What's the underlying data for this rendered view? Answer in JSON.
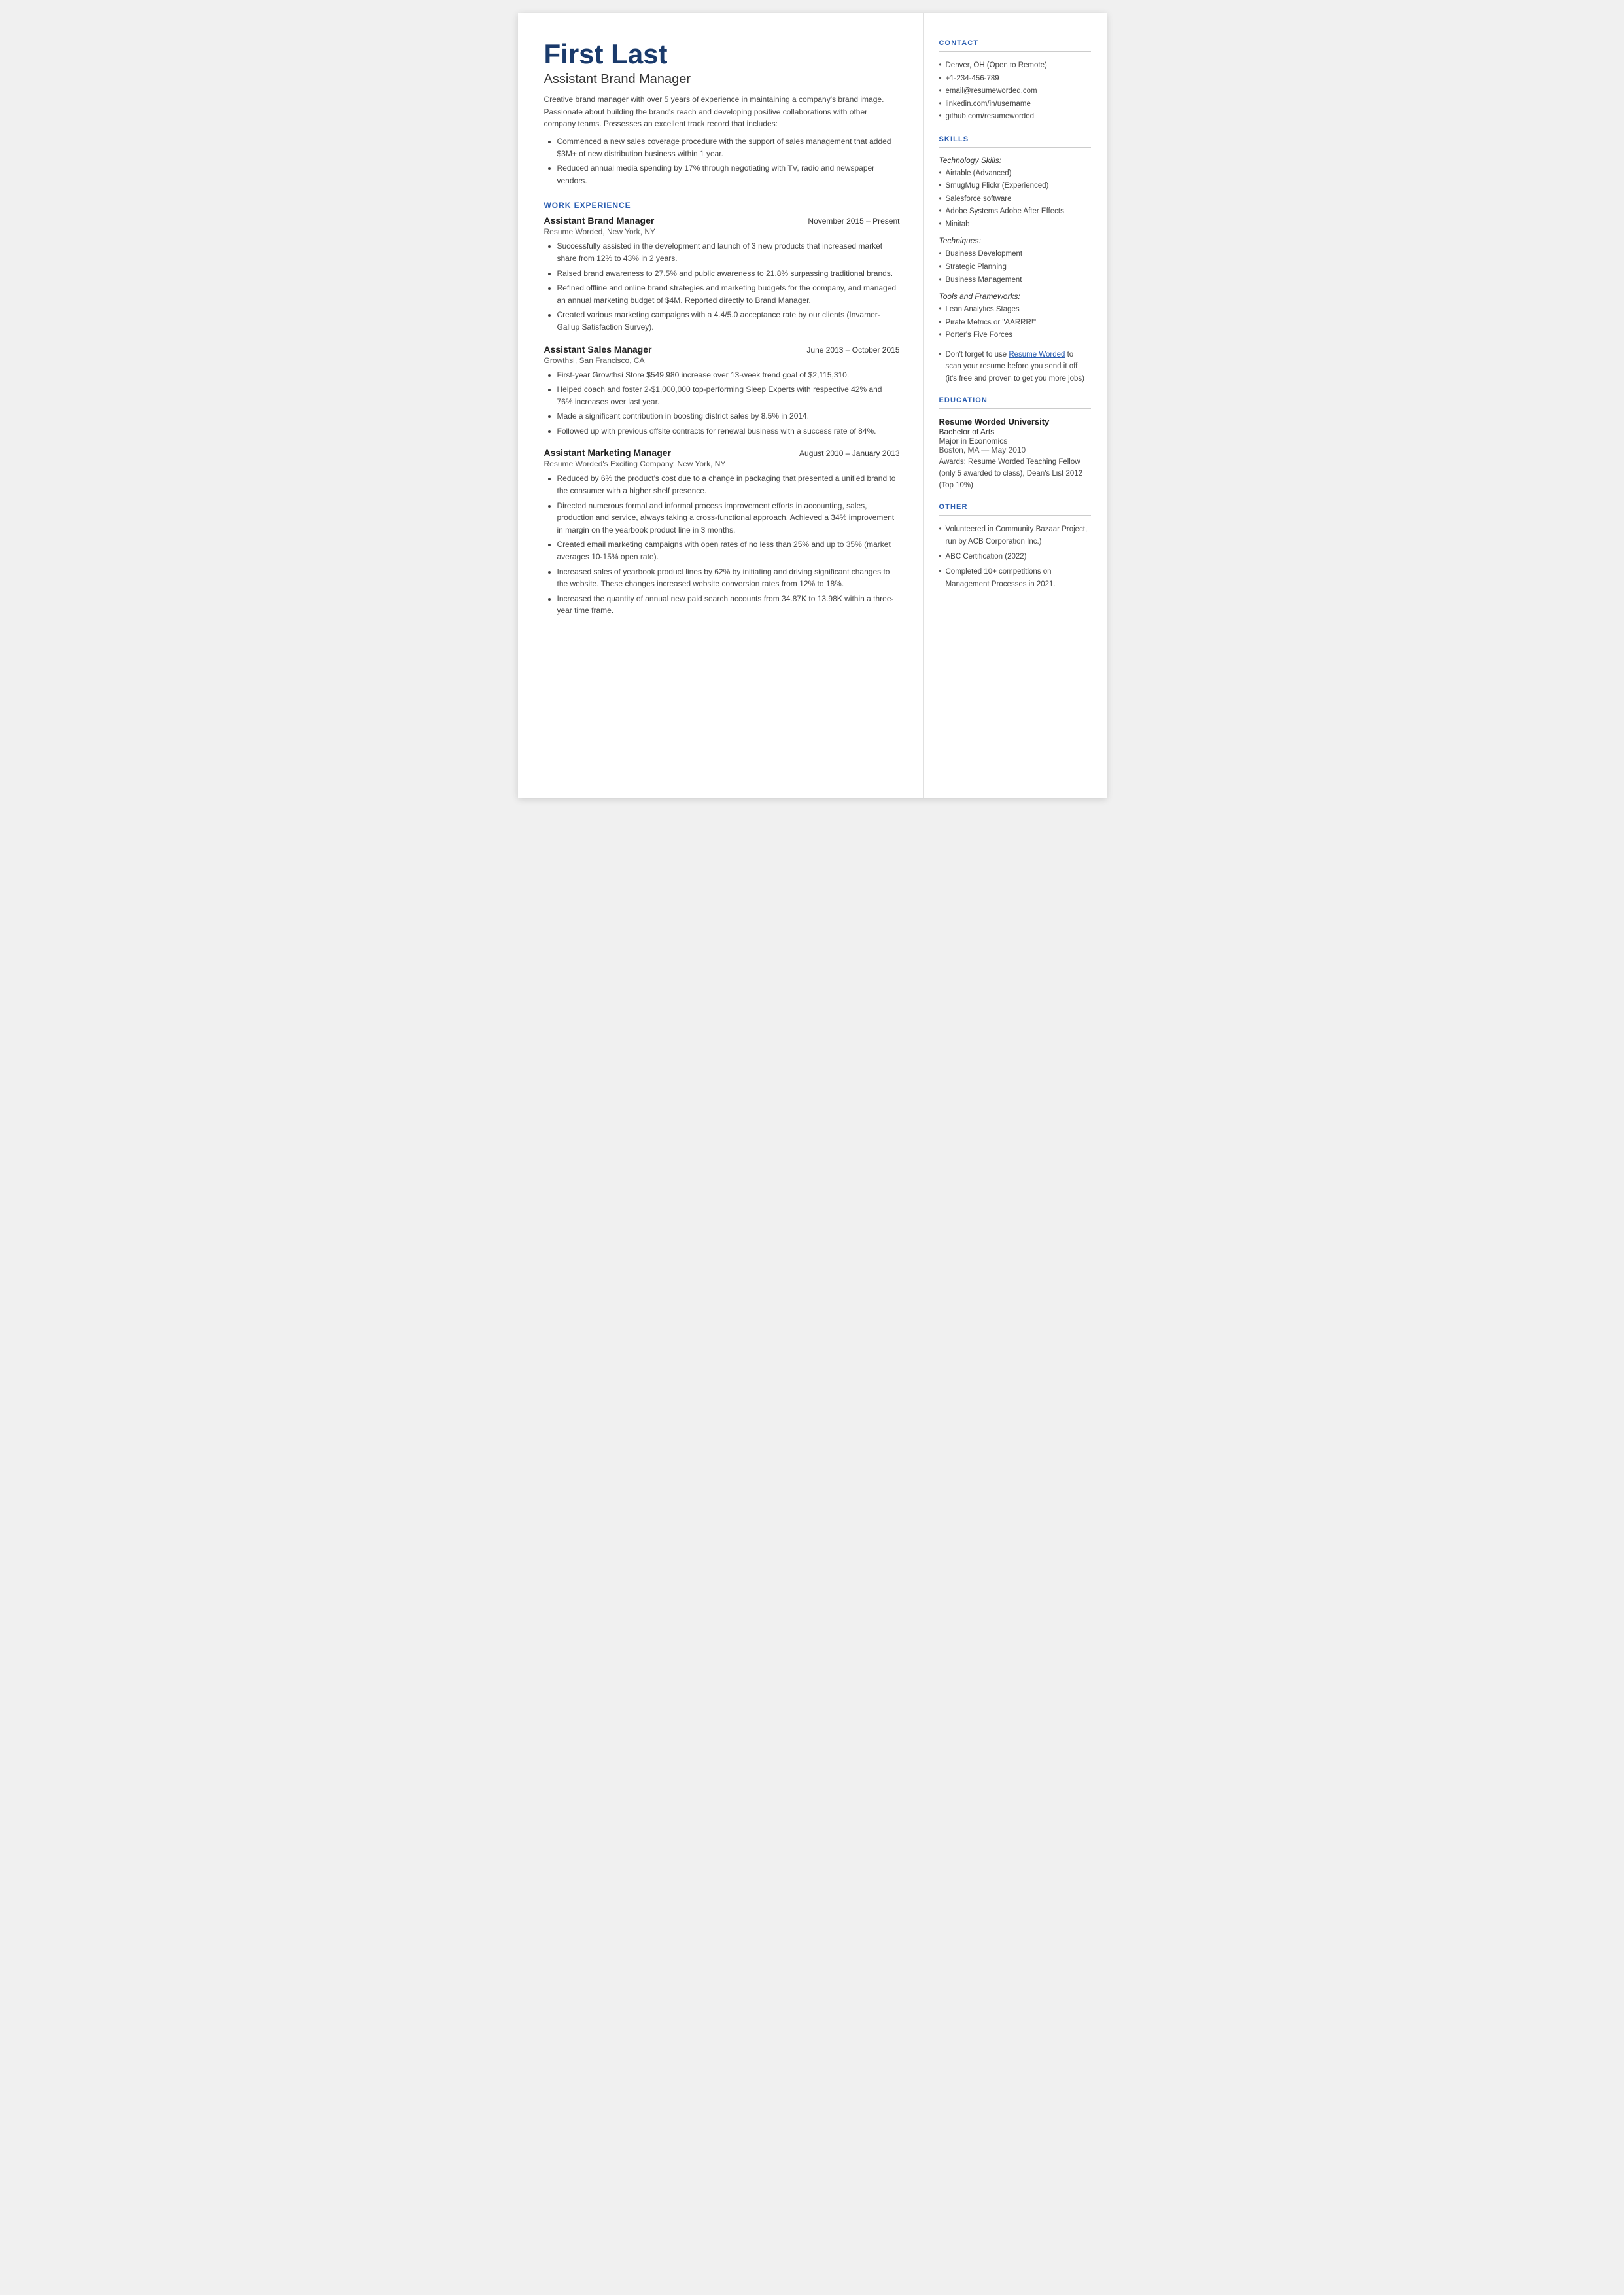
{
  "header": {
    "name": "First Last",
    "job_title": "Assistant Brand Manager",
    "summary": "Creative brand manager with over 5 years of experience in maintaining a company's brand image. Passionate about building the brand's reach and developing positive collaborations with other company teams. Possesses an excellent track record that includes:",
    "summary_bullets": [
      "Commenced a new sales coverage procedure with the support of sales management that added $3M+ of new distribution business within 1 year.",
      "Reduced annual media spending by 17% through negotiating with TV, radio and newspaper vendors."
    ]
  },
  "sections": {
    "work_experience_label": "WORK EXPERIENCE",
    "jobs": [
      {
        "title": "Assistant Brand Manager",
        "date": "November 2015 – Present",
        "company": "Resume Worded, New York, NY",
        "bullets": [
          "Successfully assisted in the development and launch of 3 new products that increased market share from 12% to 43% in 2 years.",
          "Raised brand awareness to 27.5% and public awareness to 21.8% surpassing traditional brands.",
          "Refined offline and online brand strategies and marketing budgets for the company, and managed an annual marketing budget of $4M. Reported directly to Brand Manager.",
          "Created various marketing campaigns with a 4.4/5.0 acceptance rate by our clients (Invamer-Gallup Satisfaction Survey)."
        ]
      },
      {
        "title": "Assistant Sales Manager",
        "date": "June 2013 – October 2015",
        "company": "Growthsi, San Francisco, CA",
        "bullets": [
          "First-year Growthsi Store $549,980 increase over 13-week trend goal of $2,115,310.",
          "Helped coach and foster 2-$1,000,000 top-performing Sleep Experts with respective 42% and 76% increases over last year.",
          "Made a significant contribution in boosting district sales by 8.5% in 2014.",
          "Followed up with previous offsite contracts for renewal business with a success rate of 84%."
        ]
      },
      {
        "title": "Assistant Marketing Manager",
        "date": "August 2010 – January 2013",
        "company": "Resume Worded's Exciting Company, New York, NY",
        "bullets": [
          "Reduced by 6% the product's cost due to a change in packaging that presented a unified brand to the consumer with a higher shelf presence.",
          "Directed numerous formal and informal process improvement efforts in accounting, sales, production and service, always taking a cross-functional approach. Achieved a 34% improvement in margin on the yearbook product line in 3 months.",
          "Created email marketing campaigns with open rates of no less than 25% and up to 35% (market averages 10-15% open rate).",
          "Increased sales of yearbook product lines by 62% by initiating and driving significant changes to the website. These changes increased website conversion rates from 12% to 18%.",
          "Increased the quantity of annual new paid search accounts from 34.87K to 13.98K within a three-year time frame."
        ]
      }
    ]
  },
  "sidebar": {
    "contact_label": "CONTACT",
    "contact_items": [
      "Denver, OH (Open to Remote)",
      "+1-234-456-789",
      "email@resumeworded.com",
      "linkedin.com/in/username",
      "github.com/resumeworded"
    ],
    "skills_label": "SKILLS",
    "tech_skills_label": "Technology Skills:",
    "tech_skills": [
      "Airtable (Advanced)",
      "SmugMug Flickr (Experienced)",
      "Salesforce software",
      "Adobe Systems Adobe After Effects",
      "Minitab"
    ],
    "techniques_label": "Techniques:",
    "techniques": [
      "Business Development",
      "Strategic Planning",
      "Business Management"
    ],
    "tools_label": "Tools and Frameworks:",
    "tools": [
      "Lean Analytics Stages",
      "Pirate Metrics or \"AARRR!\"",
      "Porter's Five Forces"
    ],
    "skills_note_text": "Don't forget to use ",
    "skills_note_link": "Resume Worded",
    "skills_note_rest": " to scan your resume before you send it off (it's free and proven to get you more jobs)",
    "education_label": "EDUCATION",
    "education": {
      "school": "Resume Worded University",
      "degree": "Bachelor of Arts",
      "major": "Major in Economics",
      "date": "Boston, MA — May 2010",
      "awards": "Awards: Resume Worded Teaching Fellow (only 5 awarded to class), Dean's List 2012 (Top 10%)"
    },
    "other_label": "OTHER",
    "other_items": [
      "Volunteered in Community Bazaar Project, run by ACB Corporation Inc.)",
      "ABC Certification (2022)",
      "Completed 10+ competitions on Management Processes in 2021."
    ]
  }
}
